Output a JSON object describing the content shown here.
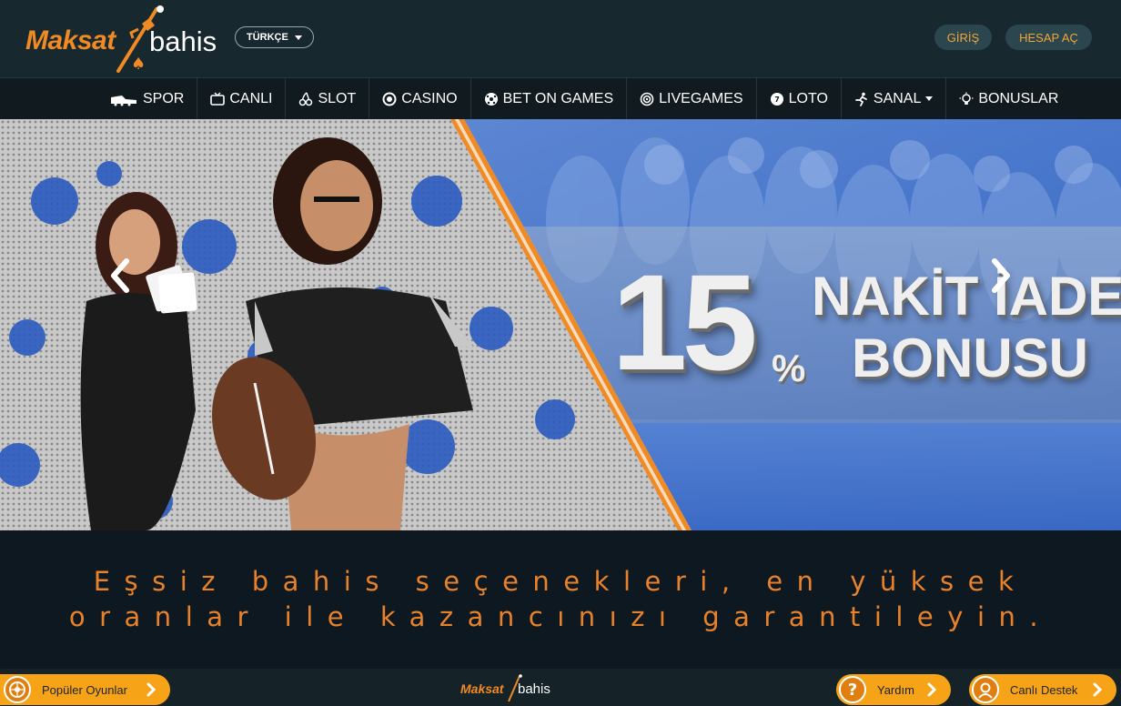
{
  "brand": {
    "name_part1": "Maksat",
    "name_part2": "bahis",
    "accent_color": "#f08a24"
  },
  "header": {
    "language": "TÜRKÇE",
    "login_label": "GİRİŞ",
    "register_label": "HESAP AÇ"
  },
  "nav": {
    "items": [
      {
        "label": "SPOR",
        "icon": "football-boot-icon"
      },
      {
        "label": "CANLI",
        "icon": "tv-icon"
      },
      {
        "label": "SLOT",
        "icon": "cherries-icon"
      },
      {
        "label": "CASINO",
        "icon": "casino-chip-icon"
      },
      {
        "label": "BET ON GAMES",
        "icon": "game-ball-icon"
      },
      {
        "label": "LIVEGAMES",
        "icon": "live-target-icon"
      },
      {
        "label": "LOTO",
        "icon": "lottery-ball-icon"
      },
      {
        "label": "SANAL",
        "icon": "running-man-icon"
      },
      {
        "label": "BONUSLAR",
        "icon": "lightbulb-icon"
      }
    ]
  },
  "banner": {
    "percent_value": "15",
    "percent_sign": "%",
    "line1": "NAKİT İADE",
    "line2": "BONUSU"
  },
  "slogan": {
    "line1": "Eşsiz bahis seçenekleri, en yüksek",
    "line2": "oranlar ile kazancınızı garantileyin."
  },
  "footer": {
    "popular_label": "Popüler Oyunlar",
    "help_label": "Yardım",
    "support_label": "Canlı Destek",
    "button_color": "#f6a318"
  }
}
